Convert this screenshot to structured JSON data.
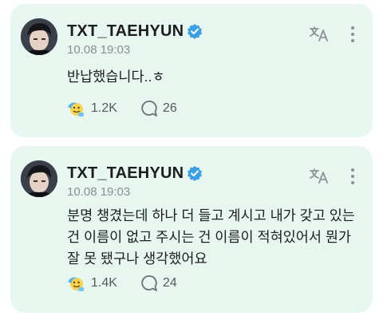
{
  "posts": [
    {
      "author": "TXT_TAEHYUN",
      "timestamp": "10.08 19:03",
      "text": "반납했습니다..ㅎ",
      "likes": "1.2K",
      "comments": "26"
    },
    {
      "author": "TXT_TAEHYUN",
      "timestamp": "10.08 19:03",
      "text": "분명 챙겼는데 하나 더 들고 계시고 내가 갖고 있는건 이름이 없고 주시는 건 이름이 적혀있어서 뭔가 잘 못 됐구나 생각했어요",
      "likes": "1.4K",
      "comments": "24"
    }
  ],
  "icons": {
    "verified": "verified-badge-icon",
    "translate": "translate-icon",
    "more": "more-vertical-icon",
    "reaction": "reaction-emoji-icon",
    "comment": "comment-bubble-icon"
  },
  "colors": {
    "card_background": "#e8f6f0",
    "verified_badge": "#3ba0e6",
    "text_primary": "#1d1d1f",
    "text_secondary": "#8b8f93"
  }
}
